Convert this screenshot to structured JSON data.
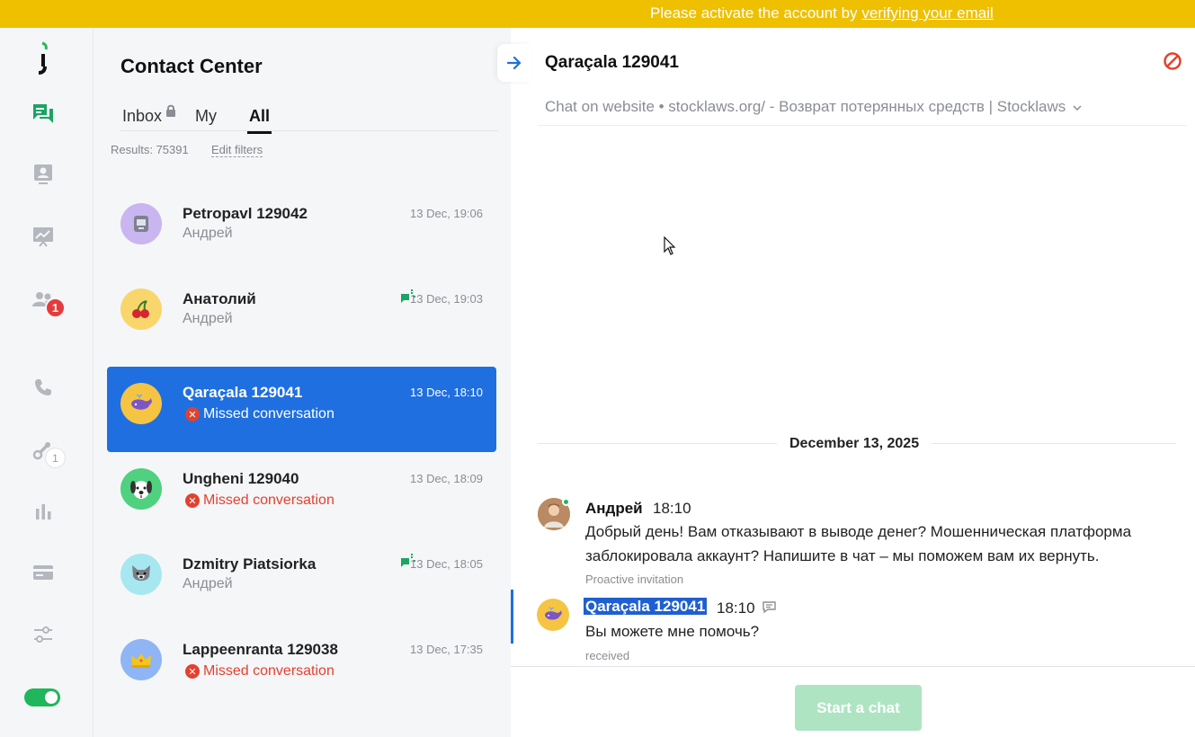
{
  "banner": {
    "prefix": "Please activate the account by ",
    "link": "verifying your email"
  },
  "rail": {
    "icons": [
      "brand-logo-icon",
      "chats-icon",
      "contacts-icon",
      "reports-icon",
      "team-icon",
      "phone-icon",
      "integrations-icon",
      "stats-icon",
      "billing-icon",
      "settings-icon"
    ],
    "team_badge": "1",
    "integrations_badge": "1",
    "status_toggle": "on"
  },
  "list": {
    "title": "Contact Center",
    "tabs": {
      "inbox": "Inbox",
      "my": "My",
      "all": "All",
      "active": "All"
    },
    "results": "Results: 75391",
    "edit_filters": "Edit filters",
    "items": [
      {
        "name": "Petropavl 129042",
        "time": "13 Dec, 19:06",
        "sub": "Андрей",
        "avatar": "robot",
        "avatar_color": "#c9b6f0",
        "missed": false,
        "typing": false
      },
      {
        "name": "Анатолий",
        "time": "13 Dec, 19:03",
        "sub": "Андрей",
        "avatar": "cherry",
        "avatar_color": "#f8d66b",
        "missed": false,
        "typing": true
      },
      {
        "name": "Qaraçala 129041",
        "time": "13 Dec, 18:10",
        "sub": "Missed conversation",
        "avatar": "whale",
        "avatar_color": "#f6c443",
        "missed": true,
        "typing": false
      },
      {
        "name": "Ungheni 129040",
        "time": "13 Dec, 18:09",
        "sub": "Missed conversation",
        "avatar": "dog",
        "avatar_color": "#4fd17f",
        "missed": true,
        "typing": false
      },
      {
        "name": "Dzmitry Piatsiorka",
        "time": "13 Dec, 18:05",
        "sub": "Андрей",
        "avatar": "wolf",
        "avatar_color": "#a7e8f0",
        "missed": false,
        "typing": true
      },
      {
        "name": "Lappeenranta 129038",
        "time": "13 Dec, 17:35",
        "sub": "Missed conversation",
        "avatar": "crown",
        "avatar_color": "#8fb5f5",
        "missed": true,
        "typing": false
      }
    ]
  },
  "chat": {
    "title": "Qaraçala 129041",
    "source": "Chat on website • stocklaws.org/ - Возврат потерянных средств | Stocklaws",
    "date": "December 13, 2025",
    "messages": [
      {
        "author": "Андрей",
        "time": "18:10",
        "text": "Добрый день! Вам отказывают в выводе денег? Мошенническая платформа заблокировала аккаунт? Напишите в чат – мы поможем вам их вернуть.",
        "meta": "Proactive invitation"
      },
      {
        "author": "Qaraçala 129041",
        "time": "18:10",
        "text": "Вы можете мне помочь?",
        "meta": "received"
      }
    ],
    "start_button": "Start a chat"
  }
}
